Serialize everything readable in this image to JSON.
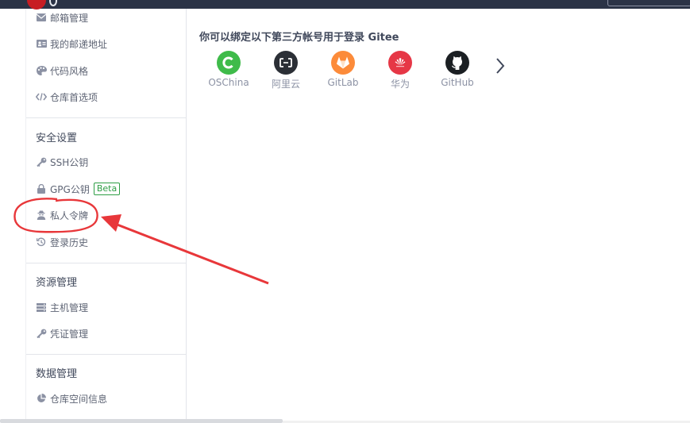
{
  "sidebar": {
    "items_top": [
      {
        "label": "邮箱管理",
        "icon": "envelope-icon"
      },
      {
        "label": "我的邮递地址",
        "icon": "address-card-icon"
      },
      {
        "label": "代码风格",
        "icon": "palette-icon"
      },
      {
        "label": "仓库首选项",
        "icon": "code-icon"
      }
    ],
    "security": {
      "title": "安全设置",
      "items": [
        {
          "label": "SSH公钥",
          "icon": "key-icon"
        },
        {
          "label": "GPG公钥",
          "icon": "lock-icon",
          "badge": "Beta"
        },
        {
          "label": "私人令牌",
          "icon": "user-secret-icon"
        },
        {
          "label": "登录历史",
          "icon": "history-icon"
        }
      ]
    },
    "resources": {
      "title": "资源管理",
      "items": [
        {
          "label": "主机管理",
          "icon": "server-icon"
        },
        {
          "label": "凭证管理",
          "icon": "key-icon"
        }
      ]
    },
    "data": {
      "title": "数据管理",
      "items": [
        {
          "label": "仓库空间信息",
          "icon": "pie-chart-icon"
        }
      ]
    }
  },
  "main": {
    "title": "你可以绑定以下第三方帐号用于登录 Gitee",
    "providers": [
      {
        "label": "OSChina",
        "icon": "oschina-icon",
        "color": "#3fbb4a"
      },
      {
        "label": "阿里云",
        "icon": "aliyun-icon",
        "color": "#2b2f36"
      },
      {
        "label": "GitLab",
        "icon": "gitlab-icon",
        "color": "#fc8b3a"
      },
      {
        "label": "华为",
        "icon": "huawei-icon",
        "color": "#e63746"
      },
      {
        "label": "GitHub",
        "icon": "github-icon",
        "color": "#1b1f23"
      }
    ]
  },
  "colors": {
    "topbar": "#2b3346",
    "brand": "#c71d23",
    "annotation": "#e8373a",
    "beta": "#2e9e45"
  }
}
